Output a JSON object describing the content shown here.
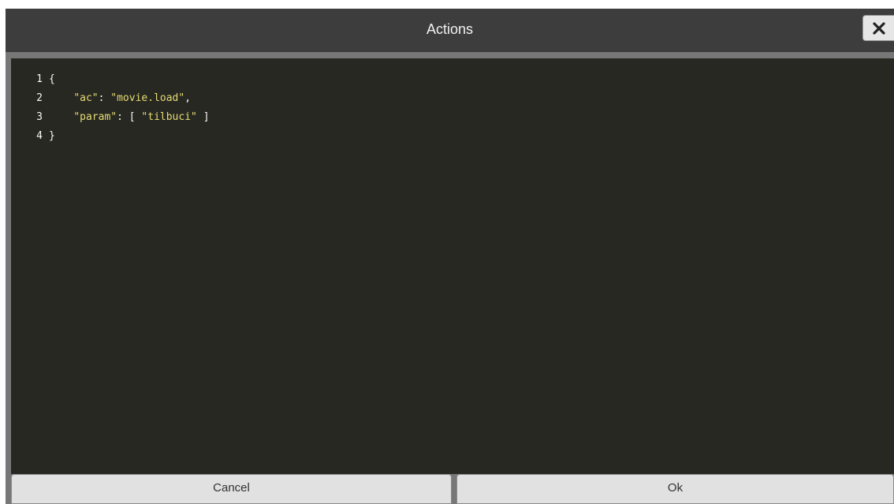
{
  "dialog": {
    "title": "Actions",
    "close_icon": "close-icon",
    "cancel_label": "Cancel",
    "ok_label": "Ok"
  },
  "editor": {
    "lines": [
      {
        "number": "1",
        "pre": "{",
        "key": "",
        "mid": "",
        "value": "",
        "post": ""
      },
      {
        "number": "2",
        "pre": "    ",
        "key": "\"ac\"",
        "mid": ": ",
        "value": "\"movie.load\"",
        "post": ","
      },
      {
        "number": "3",
        "pre": "    ",
        "key": "\"param\"",
        "mid": ": [ ",
        "value": "\"tilbuci\"",
        "post": " ]"
      },
      {
        "number": "4",
        "pre": "}",
        "key": "",
        "mid": "",
        "value": "",
        "post": ""
      }
    ]
  },
  "colors": {
    "titlebar": "#3d3d3d",
    "editor_background": "#272822",
    "string": "#e6db74",
    "text": "#f8f8f2"
  }
}
